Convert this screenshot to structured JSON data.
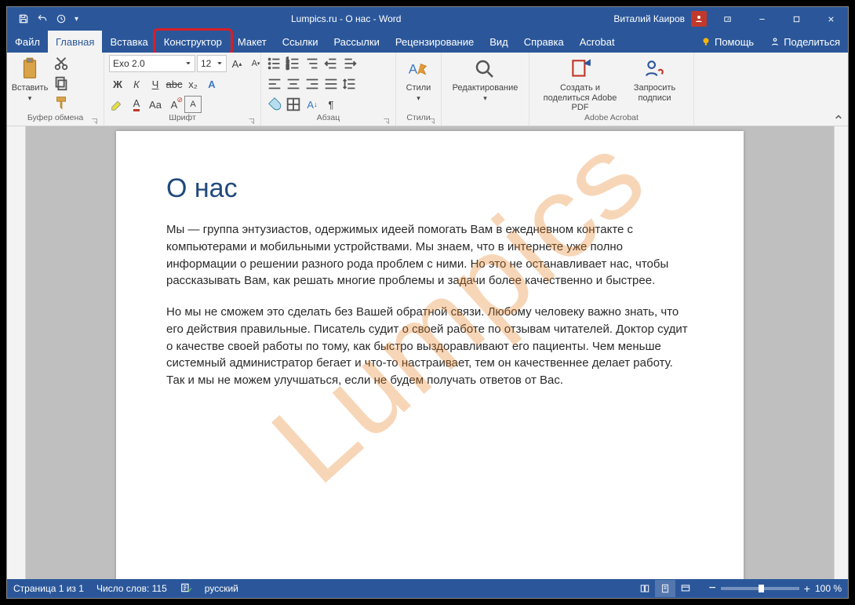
{
  "title": "Lumpics.ru - О нас  -  Word",
  "user": "Виталий Каиров",
  "tabs": {
    "file": "Файл",
    "home": "Главная",
    "insert": "Вставка",
    "design": "Конструктор",
    "layout": "Макет",
    "references": "Ссылки",
    "mailings": "Рассылки",
    "review": "Рецензирование",
    "view": "Вид",
    "help": "Справка",
    "acrobat": "Acrobat",
    "tellme": "Помощь",
    "share": "Поделиться"
  },
  "ribbon": {
    "paste": "Вставить",
    "clipboard_label": "Буфер обмена",
    "font_name": "Exo 2.0",
    "font_size": "12",
    "font_label": "Шрифт",
    "para_label": "Абзац",
    "styles": "Стили",
    "styles_label": "Стили",
    "editing": "Редактирование",
    "acrobat_make": "Создать и поделиться Adobe PDF",
    "acrobat_sign": "Запросить подписи",
    "acrobat_label": "Adobe Acrobat"
  },
  "doc": {
    "watermark": "Lumpics",
    "heading": "О нас",
    "p1": "Мы — группа энтузиастов, одержимых идеей помогать Вам в ежедневном контакте с компьютерами и мобильными устройствами. Мы знаем, что в интернете уже полно информации о решении разного рода проблем с ними. Но это не останавливает нас, чтобы рассказывать Вам, как решать многие проблемы и задачи более качественно и быстрее.",
    "p2": "Но мы не сможем это сделать без Вашей обратной связи. Любому человеку важно знать, что его действия правильные. Писатель судит о своей работе по отзывам читателей. Доктор судит о качестве своей работы по тому, как быстро выздоравливают его пациенты. Чем меньше системный администратор бегает и что-то настраивает, тем он качественнее делает работу. Так и мы не можем улучшаться, если не будем получать ответов от Вас."
  },
  "status": {
    "page": "Страница 1 из 1",
    "words": "Число слов: 115",
    "lang": "русский",
    "zoom": "100 %"
  }
}
